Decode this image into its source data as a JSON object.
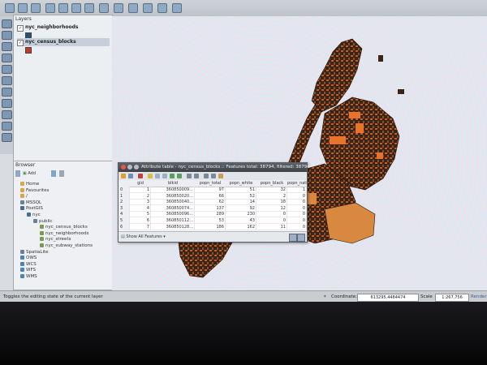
{
  "layers_panel": {
    "title": "Layers",
    "layers": [
      {
        "name": "nyc_neighborhoods",
        "checked": true,
        "swatch_color": "#2a5078"
      },
      {
        "name": "nyc_census_blocks",
        "checked": true,
        "swatch_color": "#c0392b"
      }
    ]
  },
  "browser_panel": {
    "title": "Browser",
    "add_label": "Add",
    "items": [
      {
        "label": "Home",
        "icon": "home-icon",
        "color": "#d4a84a"
      },
      {
        "label": "Favourites",
        "icon": "star-icon",
        "color": "#d4a84a"
      },
      {
        "label": "/",
        "icon": "folder-icon",
        "color": "#d4a84a"
      },
      {
        "label": "MSSQL",
        "icon": "database-icon",
        "color": "#6a7f99"
      },
      {
        "label": "PostGIS",
        "icon": "elephant-icon",
        "color": "#4a6b94"
      },
      {
        "label": "nyc",
        "icon": "connection-icon",
        "color": "#4a6b94"
      },
      {
        "label": "public",
        "icon": "schema-icon",
        "color": "#6a7f99"
      },
      {
        "label": "nyc_census_blocks",
        "icon": "polygon-layer-icon",
        "color": "#7a9a55"
      },
      {
        "label": "nyc_neighborhoods",
        "icon": "polygon-layer-icon",
        "color": "#7a9a55"
      },
      {
        "label": "nyc_streets",
        "icon": "line-layer-icon",
        "color": "#7a9a55"
      },
      {
        "label": "nyc_subway_stations",
        "icon": "point-layer-icon",
        "color": "#7a9a55"
      },
      {
        "label": "SpatiaLite",
        "icon": "feather-icon",
        "color": "#6a7f99"
      },
      {
        "label": "OWS",
        "icon": "globe-icon",
        "color": "#4a84b5"
      },
      {
        "label": "WCS",
        "icon": "globe-icon",
        "color": "#4a84b5"
      },
      {
        "label": "WFS",
        "icon": "globe-icon",
        "color": "#4a84b5"
      },
      {
        "label": "WMS",
        "icon": "globe-icon",
        "color": "#4a84b5"
      }
    ]
  },
  "attribute_table": {
    "title": "Attribute table - nyc_census_blocks :: Features total: 38794, filtered: 38794",
    "columns": [
      "gid",
      "blkid",
      "popn_total",
      "popn_white",
      "popn_black",
      "popn_nati"
    ],
    "rows": [
      {
        "row": "0",
        "gid": "1",
        "blkid": "360850009...",
        "popn_total": "97",
        "popn_white": "51",
        "popn_black": "32",
        "popn_nati": "1"
      },
      {
        "row": "1",
        "gid": "2",
        "blkid": "360850020...",
        "popn_total": "66",
        "popn_white": "52",
        "popn_black": "2",
        "popn_nati": "0"
      },
      {
        "row": "2",
        "gid": "3",
        "blkid": "360850040...",
        "popn_total": "62",
        "popn_white": "14",
        "popn_black": "18",
        "popn_nati": "0"
      },
      {
        "row": "3",
        "gid": "4",
        "blkid": "360850074...",
        "popn_total": "137",
        "popn_white": "92",
        "popn_black": "12",
        "popn_nati": "0"
      },
      {
        "row": "4",
        "gid": "5",
        "blkid": "360850096...",
        "popn_total": "289",
        "popn_white": "230",
        "popn_black": "0",
        "popn_nati": "0"
      },
      {
        "row": "5",
        "gid": "6",
        "blkid": "360850112...",
        "popn_total": "53",
        "popn_white": "43",
        "popn_black": "0",
        "popn_nati": "0"
      },
      {
        "row": "6",
        "gid": "7",
        "blkid": "360850128...",
        "popn_total": "186",
        "popn_white": "162",
        "popn_black": "11",
        "popn_nati": "0"
      }
    ],
    "show_all_label": "Show All Features"
  },
  "statusbar": {
    "message": "Toggles the editing state of the current layer",
    "coordinate_label": "Coordinate:",
    "coordinate_value": "613295,4484474",
    "scale_label": "Scale",
    "scale_value": "1:267,756",
    "render_label": "Render"
  },
  "colors": {
    "map_fill": "#3a2418",
    "map_accent": "#e8732a",
    "map_light": "#d98840"
  }
}
